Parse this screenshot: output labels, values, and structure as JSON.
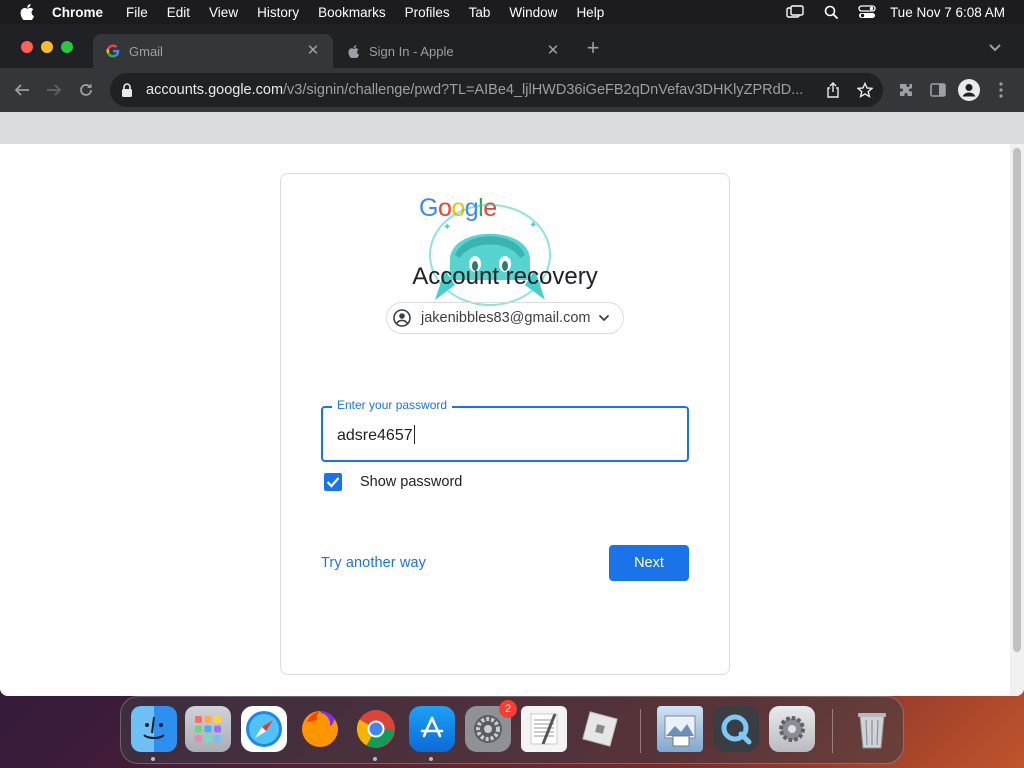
{
  "menubar": {
    "app_name": "Chrome",
    "items": [
      "File",
      "Edit",
      "View",
      "History",
      "Bookmarks",
      "Profiles",
      "Tab",
      "Window",
      "Help"
    ],
    "clock": "Tue Nov 7  6:08 AM"
  },
  "tabs": [
    {
      "label": "Gmail",
      "icon": "google-g-icon",
      "active": true
    },
    {
      "label": "Sign In - Apple",
      "icon": "apple-icon",
      "active": false
    }
  ],
  "address_bar": {
    "host": "accounts.google.com",
    "path": "/v3/signin/challenge/pwd?TL=AIBe4_ljlHWD36iGeFB2qDnVefav3DHKlyZPRdD..."
  },
  "signin": {
    "logo_letters": [
      "G",
      "o",
      "o",
      "g",
      "l",
      "e"
    ],
    "logo_colors": [
      "#4285F4",
      "#EA4335",
      "#FBBC05",
      "#4285F4",
      "#34A853",
      "#EA4335"
    ],
    "title": "Account recovery",
    "account_email": "jakenibbles83@gmail.com",
    "password_label": "Enter your password",
    "password_value": "adsre4657",
    "show_password_label": "Show password",
    "show_password_checked": true,
    "try_another_way": "Try another way",
    "next_label": "Next",
    "accent_color": "#1a73e8"
  },
  "dock": {
    "apps": [
      "finder-icon",
      "launchpad-icon",
      "safari-icon",
      "firefox-icon",
      "chrome-icon",
      "app-store-icon",
      "system-preferences-icon",
      "textedit-icon",
      "roblox-icon",
      "preview-icon",
      "quicktime-icon",
      "settings-gear-icon",
      "trash-icon"
    ],
    "system_preferences_badge": "2"
  }
}
